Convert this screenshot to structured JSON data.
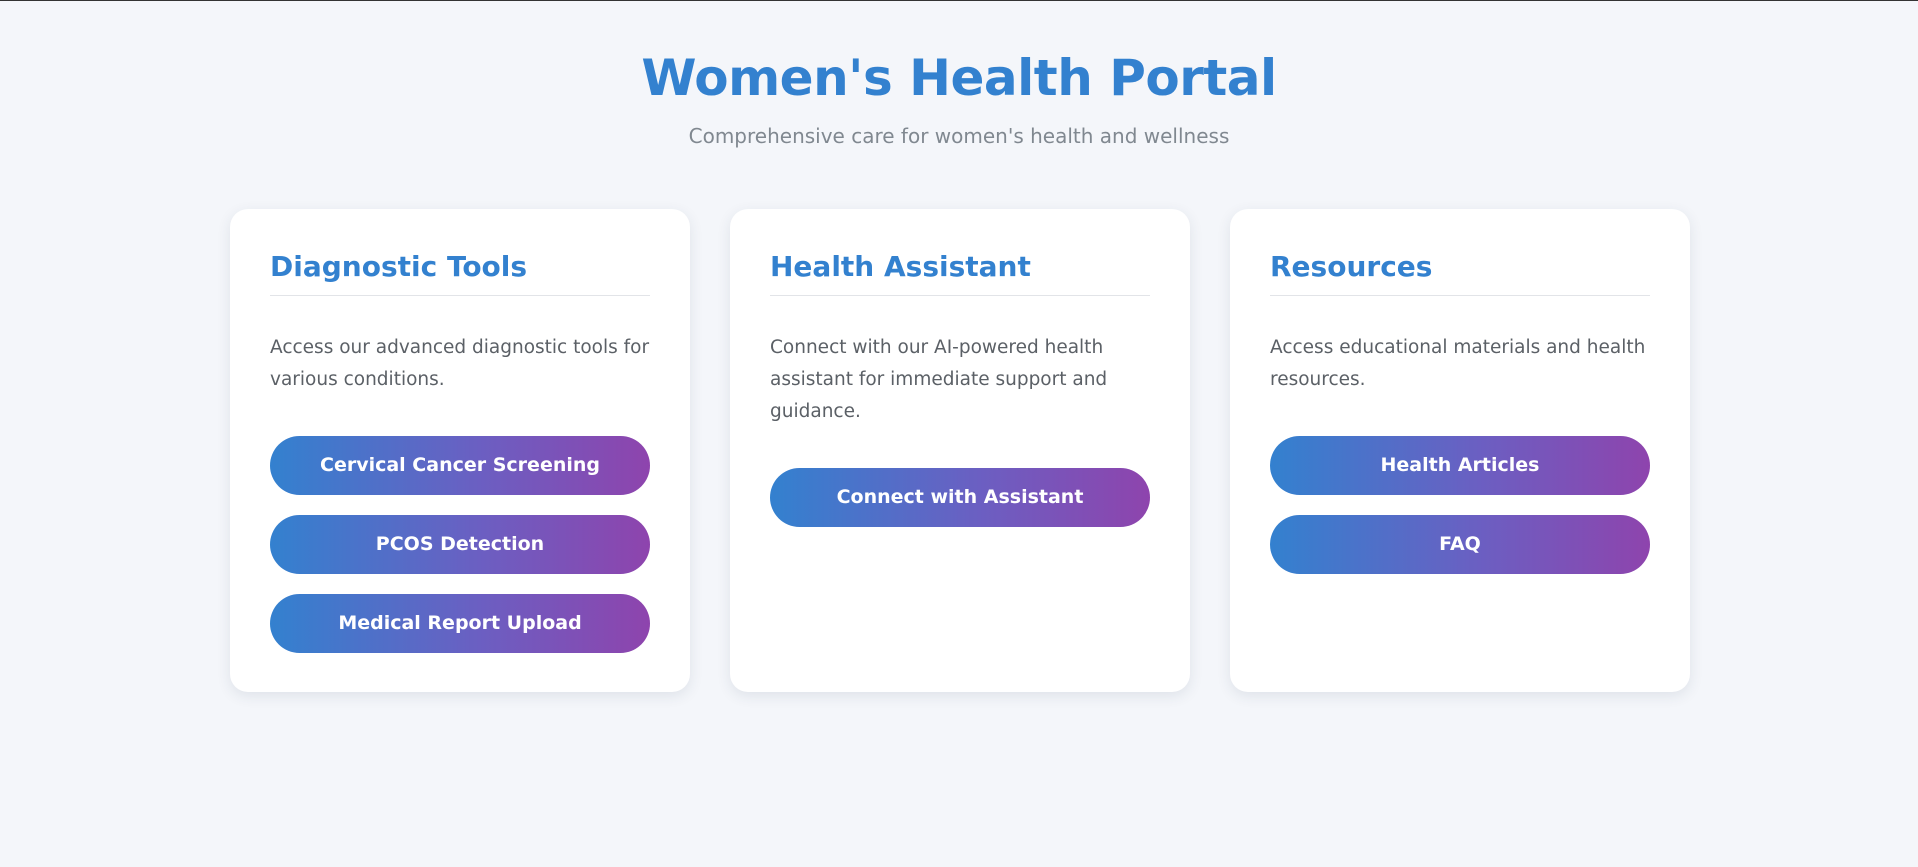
{
  "header": {
    "title": "Women's Health Portal",
    "subtitle": "Comprehensive care for women's health and wellness"
  },
  "cards": [
    {
      "title": "Diagnostic Tools",
      "description": "Access our advanced diagnostic tools for various conditions.",
      "buttons": [
        "Cervical Cancer Screening",
        "PCOS Detection",
        "Medical Report Upload"
      ]
    },
    {
      "title": "Health Assistant",
      "description": "Connect with our AI-powered health assistant for immediate support and guidance.",
      "buttons": [
        "Connect with Assistant"
      ]
    },
    {
      "title": "Resources",
      "description": "Access educational materials and health resources.",
      "buttons": [
        "Health Articles",
        "FAQ"
      ]
    }
  ],
  "colors": {
    "accent": "#3381cf",
    "gradient_start": "#3381cf",
    "gradient_end": "#8e44ad",
    "background": "#f4f6fa"
  }
}
